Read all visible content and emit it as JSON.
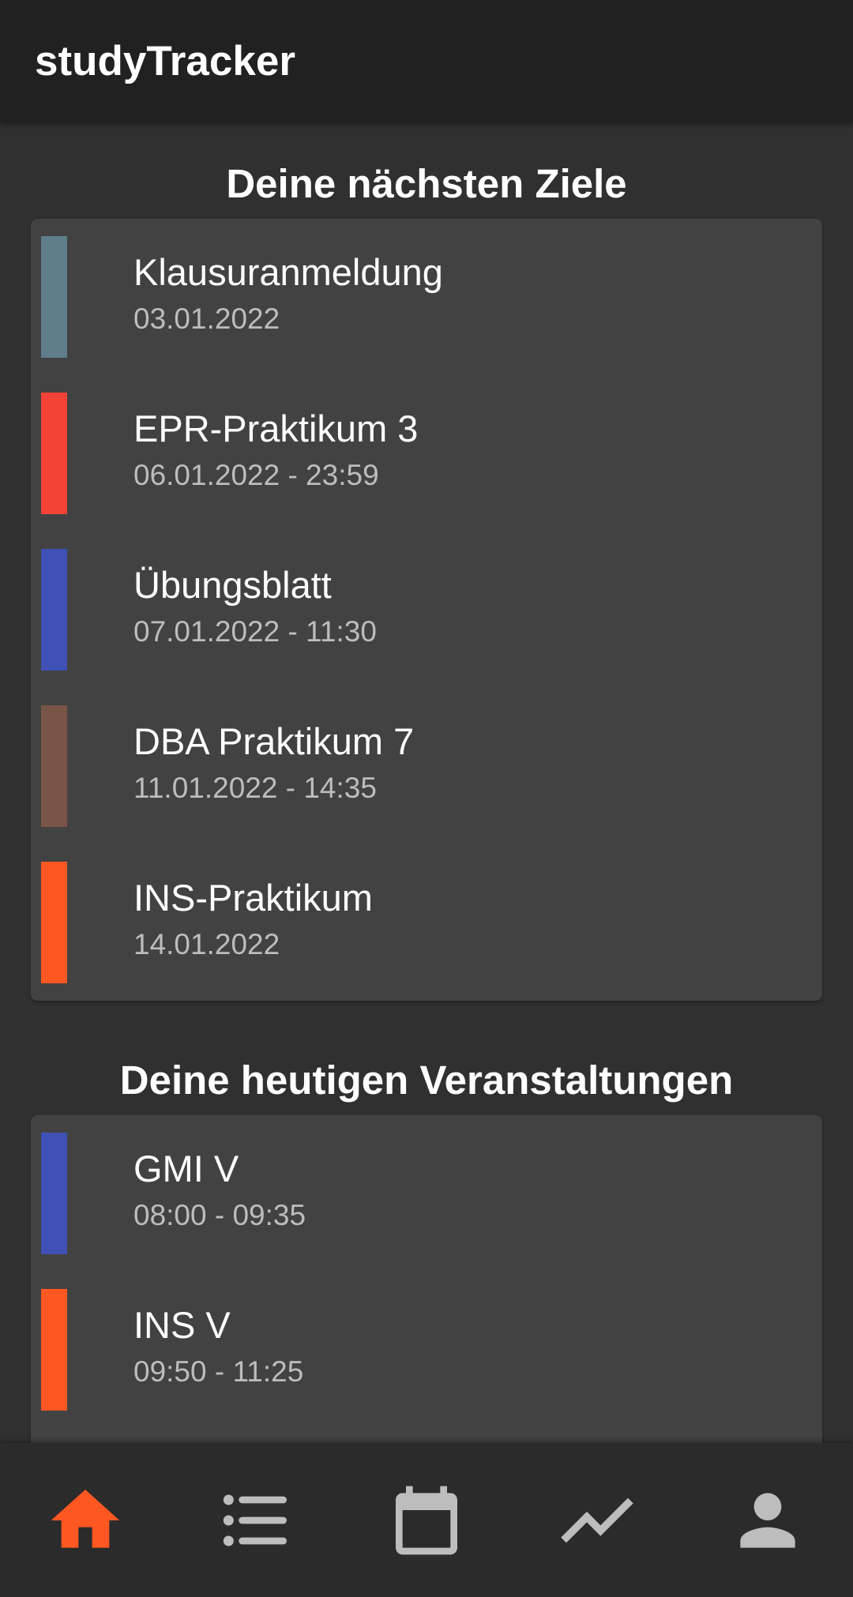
{
  "app": {
    "title": "studyTracker"
  },
  "goals_section": {
    "title": "Deine nächsten Ziele",
    "items": [
      {
        "title": "Klausuranmeldung",
        "subtitle": "03.01.2022",
        "color": "#607d8b"
      },
      {
        "title": "EPR-Praktikum 3",
        "subtitle": "06.01.2022 - 23:59",
        "color": "#f44336"
      },
      {
        "title": "Übungsblatt",
        "subtitle": "07.01.2022 - 11:30",
        "color": "#3f51b5"
      },
      {
        "title": "DBA Praktikum 7",
        "subtitle": "11.01.2022 - 14:35",
        "color": "#795548"
      },
      {
        "title": "INS-Praktikum",
        "subtitle": "14.01.2022",
        "color": "#ff5722"
      }
    ]
  },
  "events_section": {
    "title": "Deine heutigen Veranstaltungen",
    "items": [
      {
        "title": "GMI V",
        "subtitle": "08:00 - 09:35",
        "color": "#3f51b5"
      },
      {
        "title": "INS V",
        "subtitle": "09:50 - 11:25",
        "color": "#ff5722"
      }
    ]
  },
  "bottom_nav": {
    "items": [
      {
        "icon": "home-icon",
        "active": true
      },
      {
        "icon": "list-icon",
        "active": false
      },
      {
        "icon": "calendar-icon",
        "active": false
      },
      {
        "icon": "trending-icon",
        "active": false
      },
      {
        "icon": "person-icon",
        "active": false
      }
    ],
    "active_color": "#ff5722",
    "inactive_color": "#bdbdbd"
  }
}
